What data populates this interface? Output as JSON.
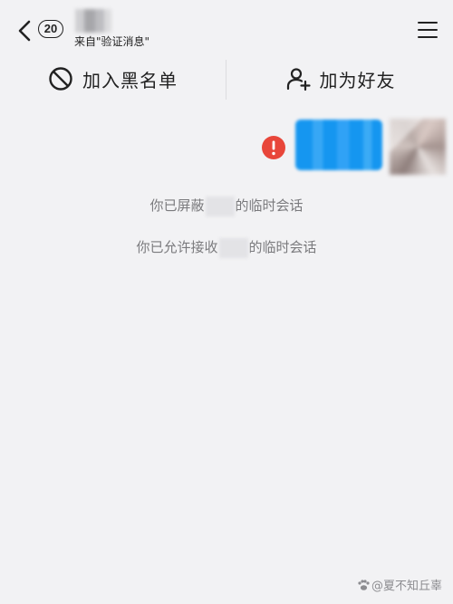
{
  "header": {
    "unread_count": "20",
    "subtitle": "来自\"验证消息\""
  },
  "actions": {
    "block_label": "加入黑名单",
    "add_friend_label": "加为好友"
  },
  "messages": {
    "blocked_prefix": "你已屏蔽",
    "blocked_suffix": "的临时会话",
    "allowed_prefix": "你已允许接收",
    "allowed_suffix": "的临时会话"
  },
  "watermark": {
    "text": "@夏不知丘辜"
  },
  "colors": {
    "background": "#f2f2f4",
    "bubble": "#1596f0",
    "error": "#e8463a",
    "text_secondary": "#7a7a7d"
  }
}
